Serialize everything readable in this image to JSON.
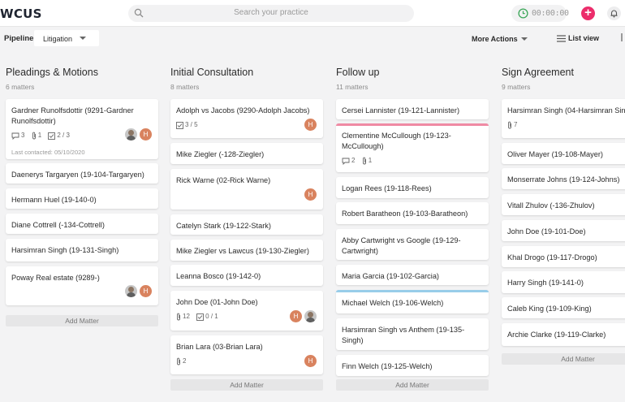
{
  "app": {
    "logo": "WCUS"
  },
  "header": {
    "search_placeholder": "Search your practice",
    "timer_value": "00:00:00",
    "add_button": "+",
    "icons": [
      "search-icon",
      "clock-icon",
      "plus-icon",
      "bell-icon"
    ]
  },
  "toolbar": {
    "pipeline_label": "Pipeline",
    "pipeline_value": "Litigation",
    "more_actions": "More Actions",
    "list_view": "List view"
  },
  "colors": {
    "accent_pink": "#ec2d6b",
    "avatar_orange": "#d9835f",
    "pink_stripe": "#ef8aa4",
    "blue_stripe": "#98cde9",
    "timer_green": "#3aa657"
  },
  "columns": [
    {
      "title": "Pleadings & Motions",
      "count": "6 matters",
      "add_label": "Add Matter",
      "cards": [
        {
          "title": "Gardner Runolfsdottir (9291-Gardner Runolfsdottir)",
          "comments": "3",
          "attachments": "1",
          "tasks": "2 / 3",
          "last_contacted": "Last contacted: 05/10/2020",
          "avatars": [
            "photo",
            "H"
          ]
        },
        {
          "title": "Daenerys Targaryen (19-104-Targaryen)"
        },
        {
          "title": "Hermann Huel (19-140-0)"
        },
        {
          "title": "Diane Cottrell (-134-Cottrell)"
        },
        {
          "title": "Harsimran Singh (19-131-Singh)"
        },
        {
          "title": "Poway Real estate (9289-)",
          "avatars": [
            "photo",
            "H"
          ]
        }
      ]
    },
    {
      "title": "Initial Consultation",
      "count": "8 matters",
      "add_label": "Add Matter",
      "cards": [
        {
          "title": "Adolph vs Jacobs (9290-Adolph Jacobs)",
          "tasks": "3 / 5",
          "avatars": [
            "H"
          ]
        },
        {
          "title": "Mike Ziegler (-128-Ziegler)"
        },
        {
          "title": "Rick Warne (02-Rick Warne)",
          "avatars": [
            "H"
          ]
        },
        {
          "title": "Catelyn Stark (19-122-Stark)"
        },
        {
          "title": "Mike Ziegler vs Lawcus (19-130-Ziegler)"
        },
        {
          "title": "Leanna Bosco (19-142-0)"
        },
        {
          "title": "John Doe (01-John Doe)",
          "attachments": "12",
          "tasks": "0 / 1",
          "avatars": [
            "H",
            "photo"
          ]
        },
        {
          "title": "Brian Lara (03-Brian Lara)",
          "attachments": "2",
          "avatars": [
            "H"
          ]
        }
      ]
    },
    {
      "title": "Follow up",
      "count": "11 matters",
      "add_label": "Add Matter",
      "cards": [
        {
          "title": "Cersei Lannister (19-121-Lannister)"
        },
        {
          "title": "Clementine McCullough (19-123-McCullough)",
          "comments": "2",
          "attachments": "1"
        },
        {
          "title": "Logan Rees (19-118-Rees)"
        },
        {
          "title": "Robert Baratheon (19-103-Baratheon)"
        },
        {
          "title": "Abby Cartwright vs Google (19-129-Cartwright)"
        },
        {
          "title": "Maria Garcia (19-102-Garcia)"
        },
        {
          "title": "Michael Welch (19-106-Welch)"
        },
        {
          "title": "Harsimran Singh vs Anthem (19-135-Singh)"
        },
        {
          "title": "Finn Welch (19-125-Welch)"
        }
      ]
    },
    {
      "title": "Sign Agreement",
      "count": "9 matters",
      "add_label": "Add Matter",
      "cards": [
        {
          "title": "Harsimran Singh (04-Harsimran Singh)",
          "attachments": "7"
        },
        {
          "title": "Oliver Mayer (19-108-Mayer)"
        },
        {
          "title": "Monserrate Johns (19-124-Johns)"
        },
        {
          "title": "Vitall Zhulov (-136-Zhulov)"
        },
        {
          "title": "John Doe (19-101-Doe)"
        },
        {
          "title": "Khal Drogo (19-117-Drogo)"
        },
        {
          "title": "Harry Singh (19-141-0)"
        },
        {
          "title": "Caleb King (19-109-King)"
        },
        {
          "title": "Archie Clarke (19-119-Clarke)"
        }
      ]
    }
  ]
}
